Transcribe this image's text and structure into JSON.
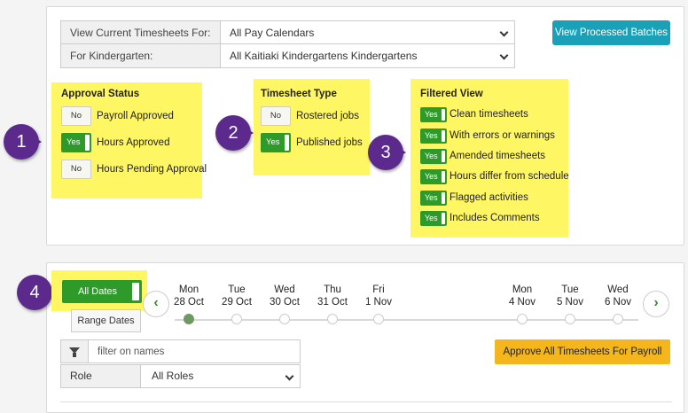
{
  "filters": {
    "view_label": "View Current Timesheets For:",
    "view_value": "All Pay Calendars",
    "kindergarten_label": "For Kindergarten:",
    "kindergarten_value": "All Kaitiaki Kindergartens Kindergartens"
  },
  "buttons": {
    "view_processed": "View Processed Batches",
    "all_dates": "All Dates",
    "range_dates": "Range Dates",
    "approve_all": "Approve All Timesheets For Payroll"
  },
  "approval_status": {
    "title": "Approval Status",
    "items": [
      {
        "state": "No",
        "label": "Payroll Approved"
      },
      {
        "state": "Yes",
        "label": "Hours Approved"
      },
      {
        "state": "No",
        "label": "Hours Pending Approval"
      }
    ]
  },
  "timesheet_type": {
    "title": "Timesheet Type",
    "items": [
      {
        "state": "No",
        "label": "Rostered jobs"
      },
      {
        "state": "Yes",
        "label": "Published jobs"
      }
    ]
  },
  "filtered_view": {
    "title": "Filtered View",
    "items": [
      {
        "state": "Yes",
        "label": "Clean timesheets"
      },
      {
        "state": "Yes",
        "label": "With errors or warnings"
      },
      {
        "state": "Yes",
        "label": "Amended timesheets"
      },
      {
        "state": "Yes",
        "label": "Hours differ from schedule"
      },
      {
        "state": "Yes",
        "label": "Flagged activities"
      },
      {
        "state": "Yes",
        "label": "Includes Comments"
      }
    ]
  },
  "badges": [
    "1",
    "2",
    "3",
    "4"
  ],
  "timeline": {
    "days": [
      {
        "dow": "Mon",
        "date": "28 Oct"
      },
      {
        "dow": "Tue",
        "date": "29 Oct"
      },
      {
        "dow": "Wed",
        "date": "30 Oct"
      },
      {
        "dow": "Thu",
        "date": "31 Oct"
      },
      {
        "dow": "Fri",
        "date": "1 Nov"
      },
      {
        "dow": "Mon",
        "date": "4 Nov"
      },
      {
        "dow": "Tue",
        "date": "5 Nov"
      },
      {
        "dow": "Wed",
        "date": "6 Nov"
      }
    ],
    "prev_icon": "‹",
    "next_icon": "›"
  },
  "name_filter": {
    "placeholder": "filter on names"
  },
  "role": {
    "label": "Role",
    "value": "All Roles"
  },
  "colors": {
    "highlight": "#fff663",
    "teal": "#1ba1b7",
    "green": "#2e9a2a",
    "badge": "#5b2a8c",
    "amber": "#f5b51d"
  }
}
